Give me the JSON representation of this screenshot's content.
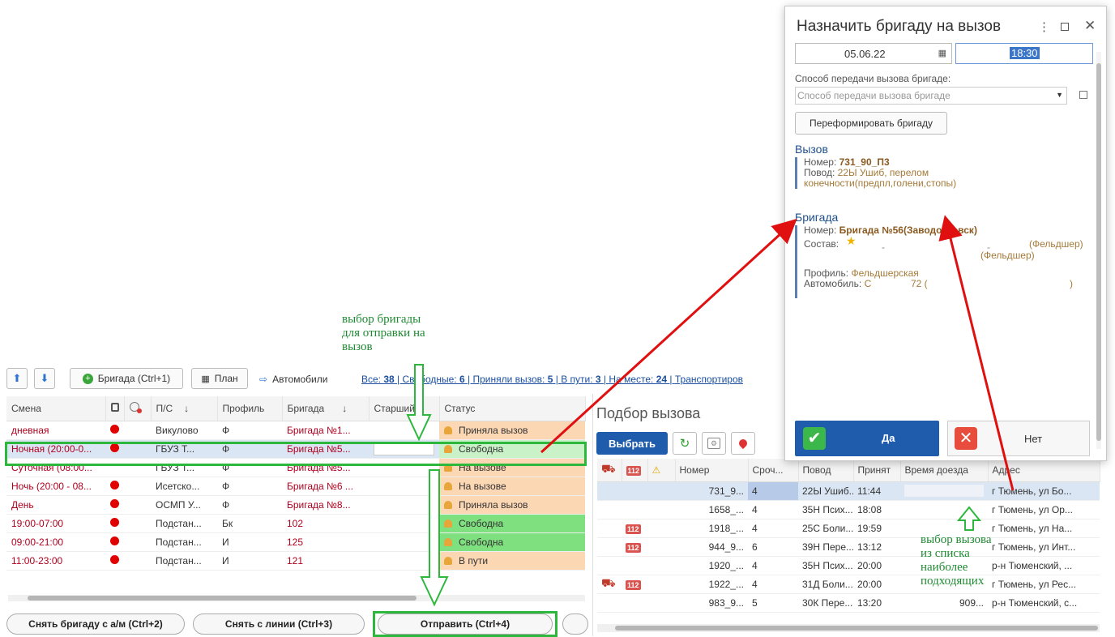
{
  "toolbar": {
    "brigade_btn": "Бригада (Ctrl+1)",
    "plan_btn": "План",
    "cars_btn": "Автомобили",
    "filters": [
      {
        "label": "Все: ",
        "count": "38"
      },
      {
        "label": "Свободные: ",
        "count": "6"
      },
      {
        "label": "Приняли вызов: ",
        "count": "5"
      },
      {
        "label": "В пути: ",
        "count": "3"
      },
      {
        "label": "На месте: ",
        "count": "24"
      },
      {
        "label": "Транспортиров",
        "count": ""
      }
    ]
  },
  "main_table": {
    "headers": [
      "Смена",
      "",
      "",
      "П/С",
      "Профиль",
      "Бригада",
      "Старший",
      "Статус"
    ],
    "sort_arrow": "↓",
    "rows": [
      {
        "shift": "дневная",
        "dot": true,
        "ps": "Викулово",
        "profile": "Ф",
        "brigade": "Бригада №1...",
        "status": "Приняла вызов",
        "status_color": "orange"
      },
      {
        "shift": "Ночная (20:00-0...",
        "dot": true,
        "ps": "ГБУЗ Т...",
        "profile": "Ф",
        "brigade": "Бригада №5...",
        "status": "Свободна",
        "status_color": "selgreen",
        "selected": true
      },
      {
        "shift": "Суточная (08:00...",
        "dot": false,
        "ps": "ГБУЗ Т...",
        "profile": "Ф",
        "brigade": "Бригада №5...",
        "status": "На вызове",
        "status_color": "orange"
      },
      {
        "shift": "Ночь (20:00 - 08...",
        "dot": true,
        "ps": "Исетско...",
        "profile": "Ф",
        "brigade": "Бригада №6 ...",
        "status": "На вызове",
        "status_color": "orange"
      },
      {
        "shift": "День",
        "dot": true,
        "ps": "ОСМП У...",
        "profile": "Ф",
        "brigade": "Бригада №8...",
        "status": "Приняла вызов",
        "status_color": "orange"
      },
      {
        "shift": "19:00-07:00",
        "dot": true,
        "ps": "Подстан...",
        "profile": "Бк",
        "brigade": "102",
        "status": "Свободна",
        "status_color": "green"
      },
      {
        "shift": "09:00-21:00",
        "dot": true,
        "ps": "Подстан...",
        "profile": "И",
        "brigade": "125",
        "status": "Свободна",
        "status_color": "green"
      },
      {
        "shift": "11:00-23:00",
        "dot": true,
        "ps": "Подстан...",
        "profile": "И",
        "brigade": "121",
        "status": "В пути",
        "status_color": "orange"
      }
    ]
  },
  "bottom_buttons": {
    "remove_car": "Снять бригаду с а/м (Ctrl+2)",
    "remove_line": "Снять с линии (Ctrl+3)",
    "send": "Отправить (Ctrl+4)"
  },
  "annotations": {
    "brigade_choice": [
      "выбор бригады",
      "для отправки на",
      "вызов"
    ],
    "call_choice": [
      "выбор вызова",
      "из списка",
      "наиболее",
      "подходящих"
    ]
  },
  "podbor": {
    "title": "Подбор вызова",
    "select_btn": "Выбрать",
    "headers": [
      "",
      "",
      "",
      "Номер",
      "Сроч...",
      "Повод",
      "Принят",
      "Время доезда",
      "Адрес"
    ],
    "rows": [
      {
        "icons": [],
        "number": "731_9...",
        "urgency": "4",
        "reason": "22Ы Ушиб...",
        "accepted": "11:44",
        "travel": "",
        "address": "г Тюмень, ул Бо...",
        "selected": true
      },
      {
        "icons": [],
        "number": "1658_...",
        "urgency": "4",
        "reason": "35Н Псих...",
        "accepted": "18:08",
        "travel": "",
        "address": "г Тюмень, ул Ор..."
      },
      {
        "icons": [
          "112"
        ],
        "number": "1918_...",
        "urgency": "4",
        "reason": "25С Боли...",
        "accepted": "19:59",
        "travel": "",
        "address": "г Тюмень, ул На..."
      },
      {
        "icons": [
          "112"
        ],
        "number": "944_9...",
        "urgency": "6",
        "reason": "39Н Пере...",
        "accepted": "13:12",
        "travel": "",
        "address": "г Тюмень, ул Инт..."
      },
      {
        "icons": [],
        "number": "1920_...",
        "urgency": "4",
        "reason": "35Н Псих...",
        "accepted": "20:00",
        "travel": "",
        "address": "р-н Тюменский, ..."
      },
      {
        "icons": [
          "tractor",
          "112"
        ],
        "number": "1922_...",
        "urgency": "4",
        "reason": "31Д Боли...",
        "accepted": "20:00",
        "travel": "",
        "address": "г Тюмень, ул Рес..."
      },
      {
        "icons": [],
        "number": "983_9...",
        "urgency": "5",
        "reason": "30К Пере...",
        "accepted": "13:20",
        "travel": "909...",
        "address": "р-н Тюменский, с..."
      }
    ]
  },
  "dialog": {
    "title": "Назначить бригаду на вызов",
    "date": "05.06.22",
    "time": "18:30",
    "method_label": "Способ передачи вызова бригаде:",
    "method_placeholder": "Способ передачи вызова бригаде",
    "reform_btn": "Переформировать бригаду",
    "call_section": "Вызов",
    "call_number_label": "Номер: ",
    "call_number": "731_90_П3",
    "call_reason_label": "Повод: ",
    "call_reason_1": "22Ы Ушиб, перелом",
    "call_reason_2": "конечности(предпл,голени,стопы)",
    "brigade_section": "Бригада",
    "brigade_number_label": "Номер: ",
    "brigade_number": "Бригада №56(Заводоуковск)",
    "composition_label": "Состав:",
    "composition_dash_1": "-",
    "composition_dash_2": "-",
    "composition_role_1": "(Фельдшер)",
    "composition_role_2": "(Фельдшер)",
    "profile_label": "Профиль: ",
    "profile": "Фельдшерская",
    "car_label": "Автомобиль: ",
    "car_a": "С",
    "car_b": "72 (",
    "car_c": ")",
    "yes_btn": "Да",
    "no_btn": "Нет"
  },
  "colors": {
    "highlight": "#2db83d",
    "arrow": "#e01010",
    "annotation_text": "#1e8a32",
    "yes_button": "#1f5cab"
  }
}
